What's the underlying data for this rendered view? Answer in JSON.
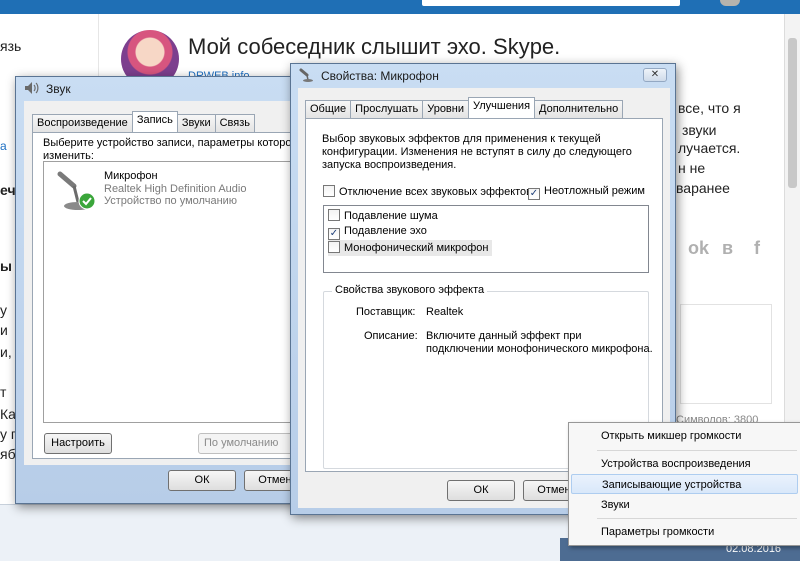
{
  "web": {
    "title": "Мой собеседник слышит эхо. Skype.",
    "author_link": "DRWEB.info",
    "left_snippets": [
      "язь",
      "а",
      "ече",
      "ы",
      "у",
      "и",
      "и,",
      "т",
      "Ка",
      "у п",
      "ябк"
    ],
    "right_snippets": [
      "все, что я",
      "звуки",
      "лучается.",
      "н не",
      "варанее"
    ],
    "social_icons": [
      "ok-icon",
      "vk-icon",
      "facebook-icon"
    ],
    "social_glyphs": [
      "ok",
      "в",
      "f"
    ],
    "counter": "Символов: 3800"
  },
  "sound_window": {
    "title": "Звук",
    "tabs": [
      "Воспроизведение",
      "Запись",
      "Звуки",
      "Связь"
    ],
    "active_tab": "Запись",
    "instruction": "Выберите устройство записи, параметры которо изменить:",
    "instruction_lines": [
      "Выберите устройство записи, параметры которо",
      "изменить:"
    ],
    "device": {
      "name": "Микрофон",
      "driver": "Realtek High Definition Audio",
      "status": "Устройство по умолчанию"
    },
    "configure_button": "Настроить",
    "default_select": "По умолчанию",
    "ok_button": "ОК",
    "cancel_button": "Отмена"
  },
  "props_window": {
    "title": "Свойства: Микрофон",
    "close_glyph": "✕",
    "tabs": [
      "Общие",
      "Прослушать",
      "Уровни",
      "Улучшения",
      "Дополнительно"
    ],
    "active_tab": "Улучшения",
    "description_lines": [
      "Выбор звуковых эффектов для применения к текущей",
      "конфигурации. Изменения не вступят в силу до следующего",
      "запуска воспроизведения."
    ],
    "disable_all": {
      "label": "Отключение всех звуковых эффектов",
      "checked": false
    },
    "immediate_mode": {
      "label": "Неотложный режим",
      "checked": true
    },
    "effects": [
      {
        "label": "Подавление шума",
        "checked": false
      },
      {
        "label": "Подавление эхо",
        "checked": true
      },
      {
        "label": "Монофонический микрофон",
        "checked": false
      }
    ],
    "effect_props_title": "Свойства звукового эффекта",
    "provider_label": "Поставщик:",
    "provider_value": "Realtek",
    "description_label": "Описание:",
    "description_value_lines": [
      "Включите данный эффект при",
      "подключении монофонического микрофона."
    ],
    "ok_button": "ОК",
    "cancel_button": "Отмена"
  },
  "context_menu": {
    "items": [
      "Открыть микшер громкости",
      "Устройства воспроизведения",
      "Записывающие устройства",
      "Звуки",
      "Параметры громкости"
    ],
    "highlighted": "Записывающие устройства"
  },
  "taskbar": {
    "date": "02.08.2016"
  },
  "colors": {
    "accent": "#1f6fb5",
    "window_frame": "#b9cfe9",
    "checkmark": "#1c3e78",
    "status_ok": "#3aa63a"
  }
}
